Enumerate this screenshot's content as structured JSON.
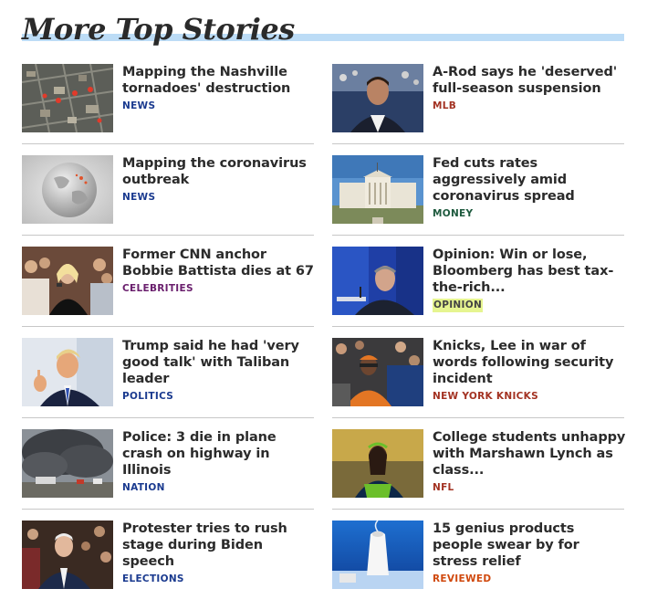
{
  "section": {
    "title": "More Top Stories"
  },
  "colors": {
    "header_bar": "#bcdcf6",
    "news": "#1a3a8f",
    "mlb": "#a33222",
    "money": "#1e5a3e",
    "celebrities": "#6a1f6d",
    "opinion_text": "#444444",
    "opinion_highlight": "#e6f590",
    "politics": "#1a3a8f",
    "new_york_knicks": "#a33222",
    "nation": "#1a3a8f",
    "nfl": "#a33222",
    "elections": "#1a3a8f",
    "reviewed": "#d0490e"
  },
  "stories": [
    {
      "headline": "Mapping the Nashville tornadoes' destruction",
      "tag": "NEWS",
      "tag_color": "#1a3a8f",
      "image": "aerial-map-image"
    },
    {
      "headline": "A-Rod says he 'deserved' full-season suspension",
      "tag": "MLB",
      "tag_color": "#a33222",
      "image": "a-rod-photo"
    },
    {
      "headline": "Mapping the coronavirus outbreak",
      "tag": "NEWS",
      "tag_color": "#1a3a8f",
      "image": "globe-image"
    },
    {
      "headline": "Fed cuts rates aggressively amid coronavirus spread",
      "tag": "MONEY",
      "tag_color": "#1e5a3e",
      "image": "federal-reserve-photo"
    },
    {
      "headline": "Former CNN anchor Bobbie Battista dies at 67",
      "tag": "CELEBRITIES",
      "tag_color": "#6a1f6d",
      "image": "anchor-photo"
    },
    {
      "headline": "Opinion: Win or lose, Bloomberg has best tax-the-rich...",
      "tag": "OPINION",
      "tag_color": "#444444",
      "tag_highlight": "#e6f590",
      "image": "bloomberg-photo"
    },
    {
      "headline": "Trump said he had 'very good talk' with Taliban leader",
      "tag": "POLITICS",
      "tag_color": "#1a3a8f",
      "image": "trump-photo"
    },
    {
      "headline": "Knicks, Lee in war of words following security incident",
      "tag": "NEW YORK KNICKS",
      "tag_color": "#a33222",
      "image": "spike-lee-photo"
    },
    {
      "headline": "Police: 3 die in plane crash on highway in Illinois",
      "tag": "NATION",
      "tag_color": "#1a3a8f",
      "image": "plane-crash-smoke-photo"
    },
    {
      "headline": "College students unhappy with Marshawn Lynch as class...",
      "tag": "NFL",
      "tag_color": "#a33222",
      "image": "marshawn-lynch-photo"
    },
    {
      "headline": "Protester tries to rush stage during Biden speech",
      "tag": "ELECTIONS",
      "tag_color": "#1a3a8f",
      "image": "biden-photo"
    },
    {
      "headline": "15 genius products people swear by for stress relief",
      "tag": "REVIEWED",
      "tag_color": "#d0490e",
      "image": "diffuser-photo"
    }
  ]
}
